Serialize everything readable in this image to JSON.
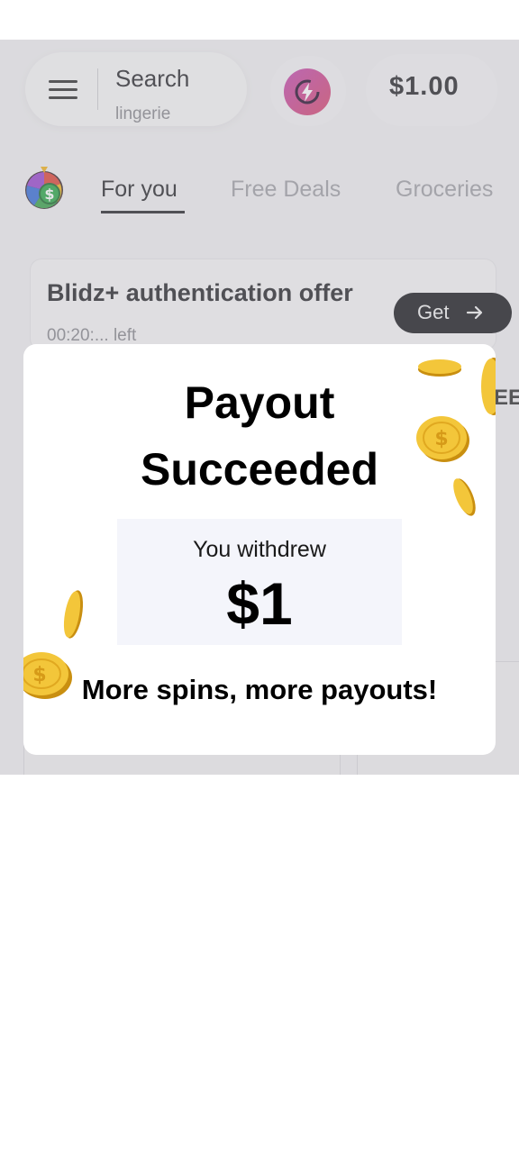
{
  "header": {
    "search_title": "Search",
    "search_placeholder": "lingerie",
    "balance": "$1.00"
  },
  "tabs": [
    {
      "label": "For you",
      "active": true
    },
    {
      "label": "Free Deals",
      "active": false
    },
    {
      "label": "Groceries",
      "active": false
    }
  ],
  "offer": {
    "title": "Blidz+ authentication offer",
    "timer": "00:20:... left",
    "button_label": "Get"
  },
  "partial_text": "EE",
  "modal": {
    "title_line1": "Payout",
    "title_line2": "Succeeded",
    "withdraw_label": "You withdrew",
    "withdraw_amount": "$1",
    "footer": "More spins, more payouts!"
  },
  "colors": {
    "accent_gradient_start": "#c44bb2",
    "accent_gradient_end": "#d84a6e",
    "coin_gold": "#f1c232"
  }
}
